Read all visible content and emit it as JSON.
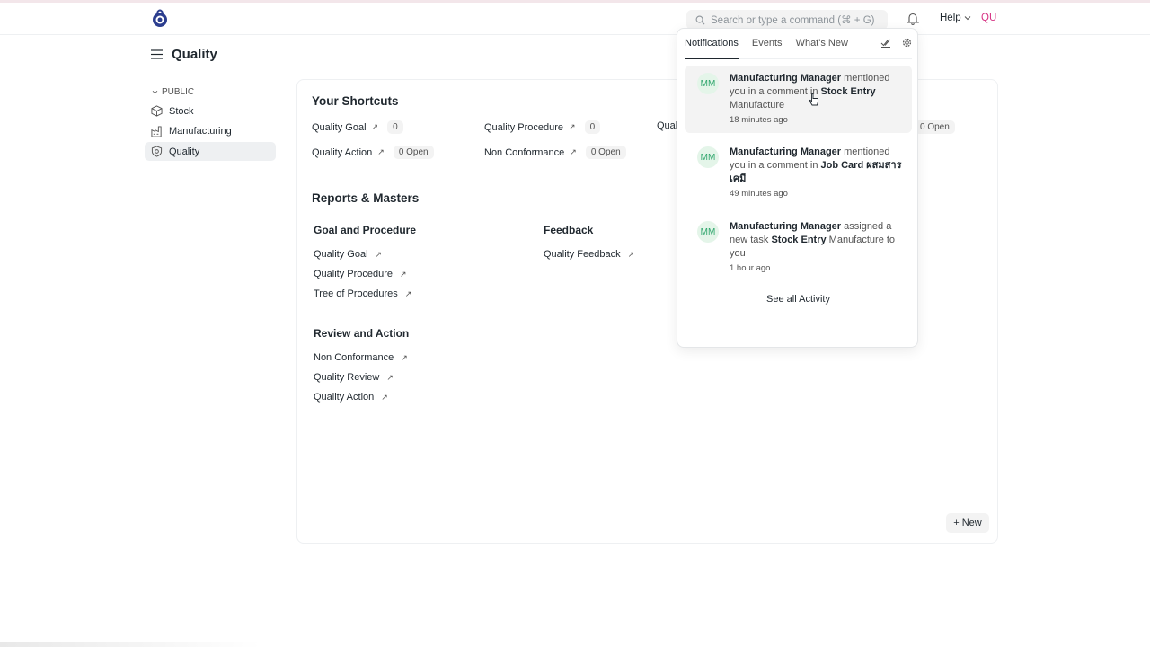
{
  "navbar": {
    "search_placeholder": "Search or type a command (⌘ + G)",
    "help_label": "Help",
    "user_initials": "QU"
  },
  "page": {
    "title": "Quality"
  },
  "sidebar": {
    "section_label": "PUBLIC",
    "items": [
      {
        "label": "Stock",
        "icon": "box-icon"
      },
      {
        "label": "Manufacturing",
        "icon": "factory-icon"
      },
      {
        "label": "Quality",
        "icon": "shield-icon",
        "active": true
      }
    ]
  },
  "shortcuts": {
    "title": "Your Shortcuts",
    "items": [
      {
        "label": "Quality Goal",
        "count": "0"
      },
      {
        "label": "Quality Procedure",
        "count": "0"
      },
      {
        "label": "Qual",
        "count": ""
      },
      {
        "label": "",
        "count": "0 Open"
      },
      {
        "label": "Quality Action",
        "count": "0 Open"
      },
      {
        "label": "Non Conformance",
        "count": "0 Open"
      }
    ]
  },
  "reports": {
    "title": "Reports & Masters",
    "groups": [
      {
        "title": "Goal and Procedure",
        "links": [
          "Quality Goal",
          "Quality Procedure",
          "Tree of Procedures"
        ]
      },
      {
        "title": "Feedback",
        "links": [
          "Quality Feedback"
        ]
      },
      {
        "title": "Review and Action",
        "links": [
          "Non Conformance",
          "Quality Review",
          "Quality Action"
        ]
      }
    ]
  },
  "new_button": "New",
  "notifications": {
    "tabs": [
      "Notifications",
      "Events",
      "What's New"
    ],
    "items": [
      {
        "initials": "MM",
        "actor": "Manufacturing Manager",
        "text1": " mentioned you in a comment in ",
        "doc": "Stock Entry",
        "text2": " Manufacture",
        "time": "18 minutes ago"
      },
      {
        "initials": "MM",
        "actor": "Manufacturing Manager",
        "text1": " mentioned you in a comment in ",
        "doc": "Job Card ผสมสารเคมี",
        "text2": "",
        "time": "49 minutes ago"
      },
      {
        "initials": "MM",
        "actor": "Manufacturing Manager",
        "text1": " assigned a new task ",
        "doc": "Stock Entry",
        "text2": " Manufacture to you",
        "time": "1 hour ago"
      }
    ],
    "see_all": "See all Activity"
  },
  "colors": {
    "avatar_bg": "#e4f5e9",
    "avatar_fg": "#30a66d",
    "user_initials": "#d63384"
  }
}
